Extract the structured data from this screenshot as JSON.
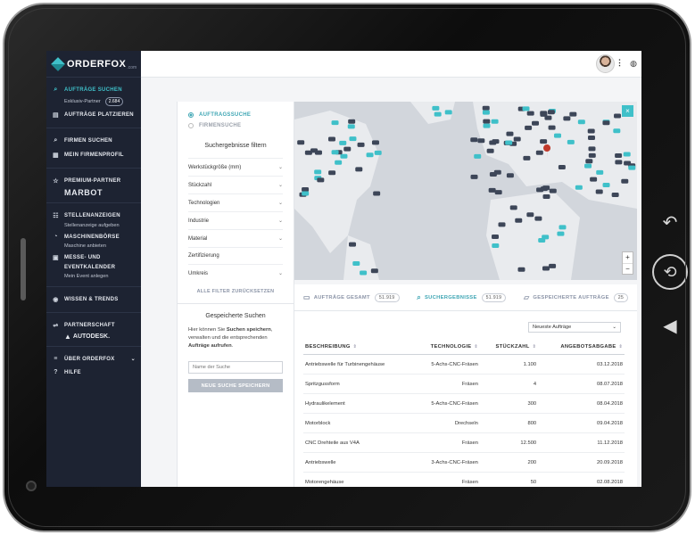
{
  "brand": {
    "name": "ORDERFOX",
    "sub": ".com"
  },
  "sidebar": {
    "groups": [
      {
        "items": [
          {
            "label": "AUFTRÄGE SUCHEN",
            "icon": "search-icon",
            "active": true
          },
          {
            "sub": "Exklusiv-Partner",
            "badge": "2.684"
          },
          {
            "label": "AUFTRÄGE PLATZIEREN",
            "icon": "document-icon"
          }
        ]
      },
      {
        "items": [
          {
            "label": "FIRMEN SUCHEN",
            "icon": "search-icon"
          },
          {
            "label": "MEIN FIRMENPROFIL",
            "icon": "profile-icon"
          }
        ]
      },
      {
        "premium_label": "PREMIUM-PARTNER",
        "premium_name": "MARBOT"
      },
      {
        "items": [
          {
            "label": "STELLENANZEIGEN",
            "icon": "people-icon",
            "sub": "Stellenanzeige aufgeben"
          },
          {
            "label": "MASCHINENBÖRSE",
            "icon": "gauge-icon",
            "sub": "Maschine anbieten"
          },
          {
            "label": "MESSE- UND",
            "label2": "EVENTKALENDER",
            "icon": "calendar-icon",
            "sub": "Mein Event anlegen"
          }
        ]
      },
      {
        "items": [
          {
            "label": "WISSEN & TRENDS",
            "icon": "lightbulb-icon"
          }
        ]
      },
      {
        "partner_label": "PARTNERSCHAFT",
        "partner_name": "AUTODESK."
      },
      {
        "items": [
          {
            "label": "ÜBER ORDERFOX",
            "icon": "menu-icon"
          },
          {
            "label": "HILFE",
            "icon": "help-icon"
          }
        ]
      }
    ]
  },
  "filters": {
    "mode_1": "AUFTRAGSSUCHE",
    "mode_2": "FIRMENSUCHE",
    "title": "Suchergebnisse filtern",
    "rows": [
      "Werkstückgröße (mm)",
      "Stückzahl",
      "Technologien",
      "Industrie",
      "Material",
      "Zertifizierung",
      "Umkreis"
    ],
    "reset": "ALLE FILTER ZURÜCKSETZEN"
  },
  "saved_searches": {
    "title": "Gespeicherte Suchen",
    "text_1": "Hier können Sie ",
    "text_bold_1": "Suchen speichern",
    "text_2": ", verwalten und die entsprechenden ",
    "text_bold_2": "Aufträge aufrufen",
    "text_3": ".",
    "input_placeholder": "Name der Suche",
    "button": "NEUE SUCHE SPEICHERN"
  },
  "stats": {
    "total_label": "AUFTRÄGE GESAMT",
    "total_value": "51.919",
    "results_label": "SUCHERGEBNISSE",
    "results_value": "51.919",
    "saved_label": "GESPEICHERTE AUFTRÄGE",
    "saved_value": "25"
  },
  "sort": {
    "selected": "Neueste Aufträge"
  },
  "table": {
    "headers": [
      "BESCHREIBUNG",
      "TECHNOLOGIE",
      "STÜCKZAHL",
      "ANGEBOTSABGABE"
    ],
    "rows": [
      [
        "Antriebswelle für Turbinengehäuse",
        "5-Achs-CNC-Fräsen",
        "1.100",
        "03.12.2018"
      ],
      [
        "Spritzgussform",
        "Fräsen",
        "4",
        "08.07.2018"
      ],
      [
        "Hydraulikelement",
        "5-Achs-CNC-Fräsen",
        "300",
        "08.04.2018"
      ],
      [
        "Motorblock",
        "Drechseln",
        "800",
        "09.04.2018"
      ],
      [
        "CNC Drehteile aus V4A",
        "Fräsen",
        "12.500",
        "11.12.2018"
      ],
      [
        "Antriebswelle",
        "3-Achs-CNC-Fräsen",
        "200",
        "20.09.2018"
      ],
      [
        "Motorengehäuse",
        "Fräsen",
        "50",
        "02.08.2018"
      ]
    ]
  },
  "map": {
    "zoom_in": "+",
    "zoom_out": "−",
    "close": "×"
  },
  "colors": {
    "accent": "#3fc0c9",
    "sidebar": "#1d2332"
  }
}
